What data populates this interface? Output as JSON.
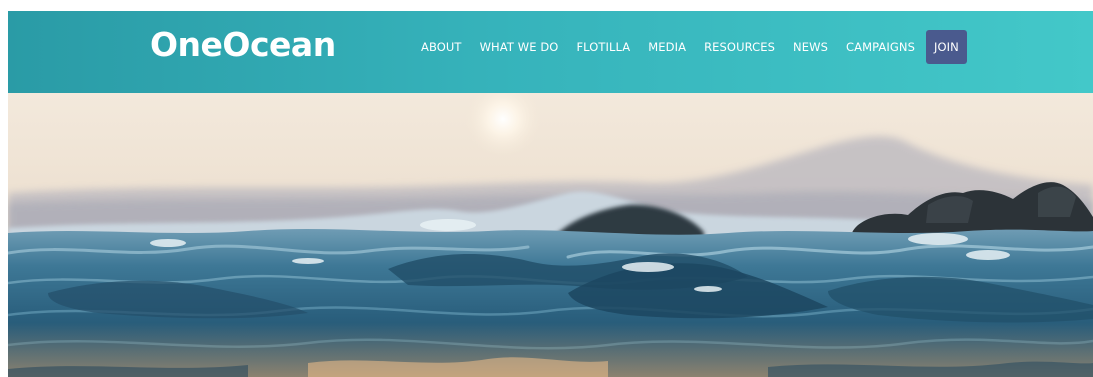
{
  "header": {
    "logo_text": "OneOcean",
    "background_color": "#36b3bb",
    "nav": [
      {
        "label": "ABOUT"
      },
      {
        "label": "WHAT WE DO"
      },
      {
        "label": "FLOTILLA"
      },
      {
        "label": "MEDIA"
      },
      {
        "label": "RESOURCES"
      },
      {
        "label": "NEWS"
      },
      {
        "label": "CAMPAIGNS"
      }
    ],
    "join_label": "JOIN",
    "join_color": "#4a5a8e"
  },
  "hero": {
    "image": "ocean-waves-sunset-photo"
  }
}
